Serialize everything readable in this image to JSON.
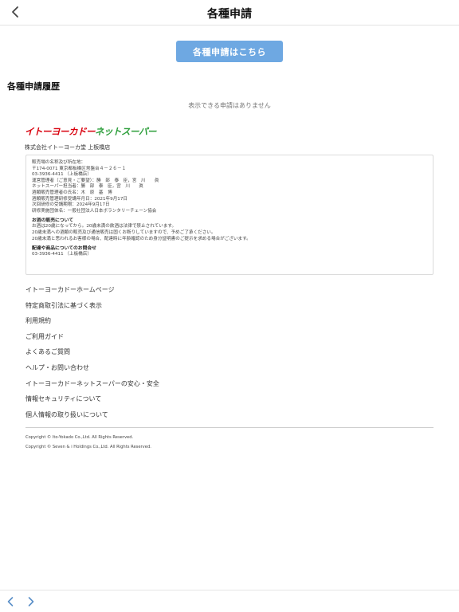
{
  "header": {
    "title": "各種申請",
    "back_icon": "chevron-left-icon"
  },
  "apply_button": "各種申請はこちら",
  "history": {
    "title": "各種申請履歴",
    "empty_message": "表示できる申請はありません"
  },
  "store": {
    "logo_part1": "イトーヨーカドー",
    "logo_part2": "ネットスーパー",
    "name": "株式会社イトーヨーカ堂 上板橋店"
  },
  "info": {
    "lines": [
      "販売場の名称及び所在地：",
      "〒174-0071 東京都板橋区常盤台４－２６－１",
      "03-3936-4411 （上板橋店）",
      "運営管理者（ご意見・ご要望）：勝　部　泰　臣，宮　川　　眞",
      "ネットスーパー担当者：勝　部　泰　臣，宮　川　　眞",
      "酒類販売管理者の氏名：木　原　基　博",
      "酒類販売管理研修受講年月日：2021年9月17日",
      "次回研修の受講期限：2024年9月17日",
      "研修実施団体名：一般社団法人日本ボランタリーチェーン協会"
    ],
    "alcohol_heading": "お酒の販売について",
    "alcohol_lines": [
      "お酒は20歳になってから。20歳未満の飲酒は法律で禁止されています。",
      "20歳未満への酒類の販売及び通信販売は固くお断りしていますので、予めご了承ください。",
      "20歳未満と思われるお客様の場合、配達時に年齢確認のため身分証明書のご提示を求める場合がございます。"
    ],
    "contact_heading": "配達や商品についてのお問合せ",
    "contact_phone": "03-3936-4411 （上板橋店）"
  },
  "footer_links": [
    "イトーヨーカドーホームページ",
    "特定商取引法に基づく表示",
    "利用規約",
    "ご利用ガイド",
    "よくあるご質問",
    "ヘルプ・お問い合わせ",
    "イトーヨーカドーネットスーパーの安心・安全",
    "情報セキュリティについて",
    "個人情報の取り扱いについて"
  ],
  "copyright": [
    "Copyright © Ito-Yokado Co.,Ltd. All Rights Reserved.",
    "Copyright © Seven & i Holdings Co.,Ltd. All Rights Reserved."
  ],
  "bottom_nav": {
    "back_icon": "chevron-left-icon",
    "forward_icon": "chevron-right-icon",
    "accent_color": "#5a8fc8"
  }
}
